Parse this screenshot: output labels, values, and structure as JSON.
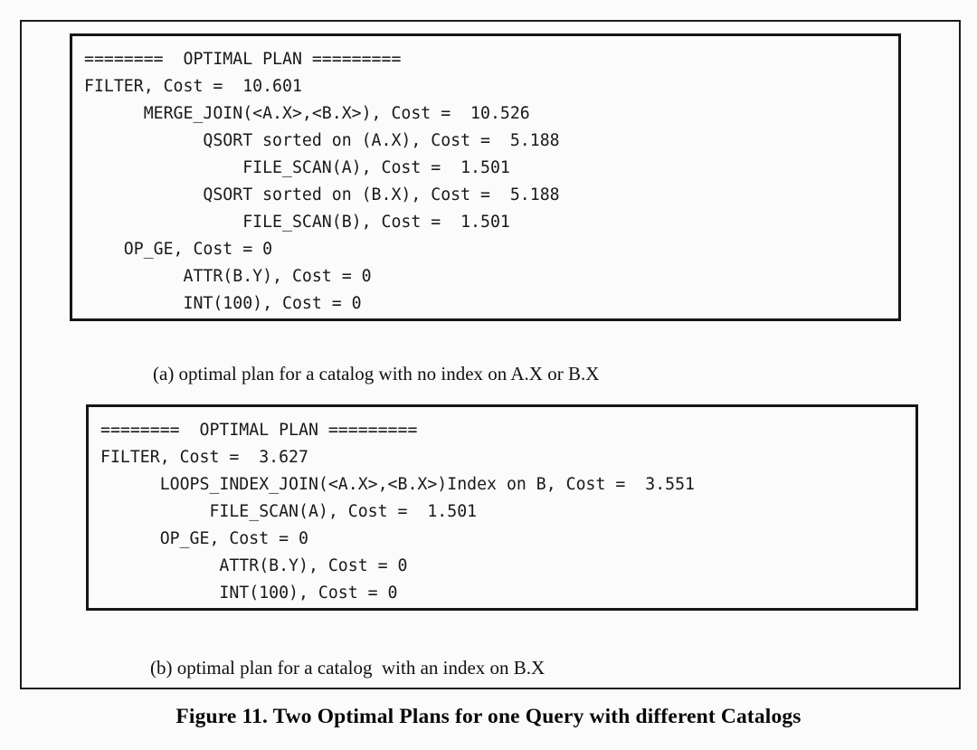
{
  "figure": {
    "caption": "Figure 11. Two Optimal Plans for one Query with different Catalogs"
  },
  "panel_a": {
    "subcaption": "(a) optimal plan for a catalog with no index on A.X or B.X",
    "listing": "========  OPTIMAL PLAN =========\nFILTER, Cost =  10.601\n      MERGE_JOIN(<A.X>,<B.X>), Cost =  10.526\n            QSORT sorted on (A.X), Cost =  5.188\n                FILE_SCAN(A), Cost =  1.501\n            QSORT sorted on (B.X), Cost =  5.188\n                FILE_SCAN(B), Cost =  1.501\n    OP_GE, Cost = 0\n          ATTR(B.Y), Cost = 0\n          INT(100), Cost = 0",
    "lines": [
      "========  OPTIMAL PLAN =========",
      "FILTER, Cost =  10.601",
      "      MERGE_JOIN(<A.X>,<B.X>), Cost =  10.526",
      "            QSORT sorted on (A.X), Cost =  5.188",
      "                FILE_SCAN(A), Cost =  1.501",
      "            QSORT sorted on (B.X), Cost =  5.188",
      "                FILE_SCAN(B), Cost =  1.501",
      "    OP_GE, Cost = 0",
      "          ATTR(B.Y), Cost = 0",
      "          INT(100), Cost = 0"
    ],
    "plan_nodes": [
      {
        "operator": "FILTER",
        "cost": "10.601",
        "depth": 0
      },
      {
        "operator": "MERGE_JOIN(<A.X>,<B.X>)",
        "cost": "10.526",
        "depth": 1
      },
      {
        "operator": "QSORT sorted on (A.X)",
        "cost": "5.188",
        "depth": 2
      },
      {
        "operator": "FILE_SCAN(A)",
        "cost": "1.501",
        "depth": 3
      },
      {
        "operator": "QSORT sorted on (B.X)",
        "cost": "5.188",
        "depth": 2
      },
      {
        "operator": "FILE_SCAN(B)",
        "cost": "1.501",
        "depth": 3
      },
      {
        "operator": "OP_GE",
        "cost": "0",
        "depth": 1
      },
      {
        "operator": "ATTR(B.Y)",
        "cost": "0",
        "depth": 2
      },
      {
        "operator": "INT(100)",
        "cost": "0",
        "depth": 2
      }
    ]
  },
  "panel_b": {
    "subcaption": "(b) optimal plan for a catalog  with an index on B.X",
    "listing": "========  OPTIMAL PLAN =========\nFILTER, Cost =  3.627\n      LOOPS_INDEX_JOIN(<A.X>,<B.X>)Index on B, Cost =  3.551\n           FILE_SCAN(A), Cost =  1.501\n      OP_GE, Cost = 0\n            ATTR(B.Y), Cost = 0\n            INT(100), Cost = 0",
    "lines": [
      "========  OPTIMAL PLAN =========",
      "FILTER, Cost =  3.627",
      "      LOOPS_INDEX_JOIN(<A.X>,<B.X>)Index on B, Cost =  3.551",
      "           FILE_SCAN(A), Cost =  1.501",
      "      OP_GE, Cost = 0",
      "            ATTR(B.Y), Cost = 0",
      "            INT(100), Cost = 0"
    ],
    "plan_nodes": [
      {
        "operator": "FILTER",
        "cost": "3.627",
        "depth": 0
      },
      {
        "operator": "LOOPS_INDEX_JOIN(<A.X>,<B.X>)Index on B",
        "cost": "3.551",
        "depth": 1
      },
      {
        "operator": "FILE_SCAN(A)",
        "cost": "1.501",
        "depth": 2
      },
      {
        "operator": "OP_GE",
        "cost": "0",
        "depth": 1
      },
      {
        "operator": "ATTR(B.Y)",
        "cost": "0",
        "depth": 2
      },
      {
        "operator": "INT(100)",
        "cost": "0",
        "depth": 2
      }
    ]
  },
  "colors": {
    "page_background": "#fbfbfb",
    "text": "#111111",
    "border": "#161616"
  }
}
